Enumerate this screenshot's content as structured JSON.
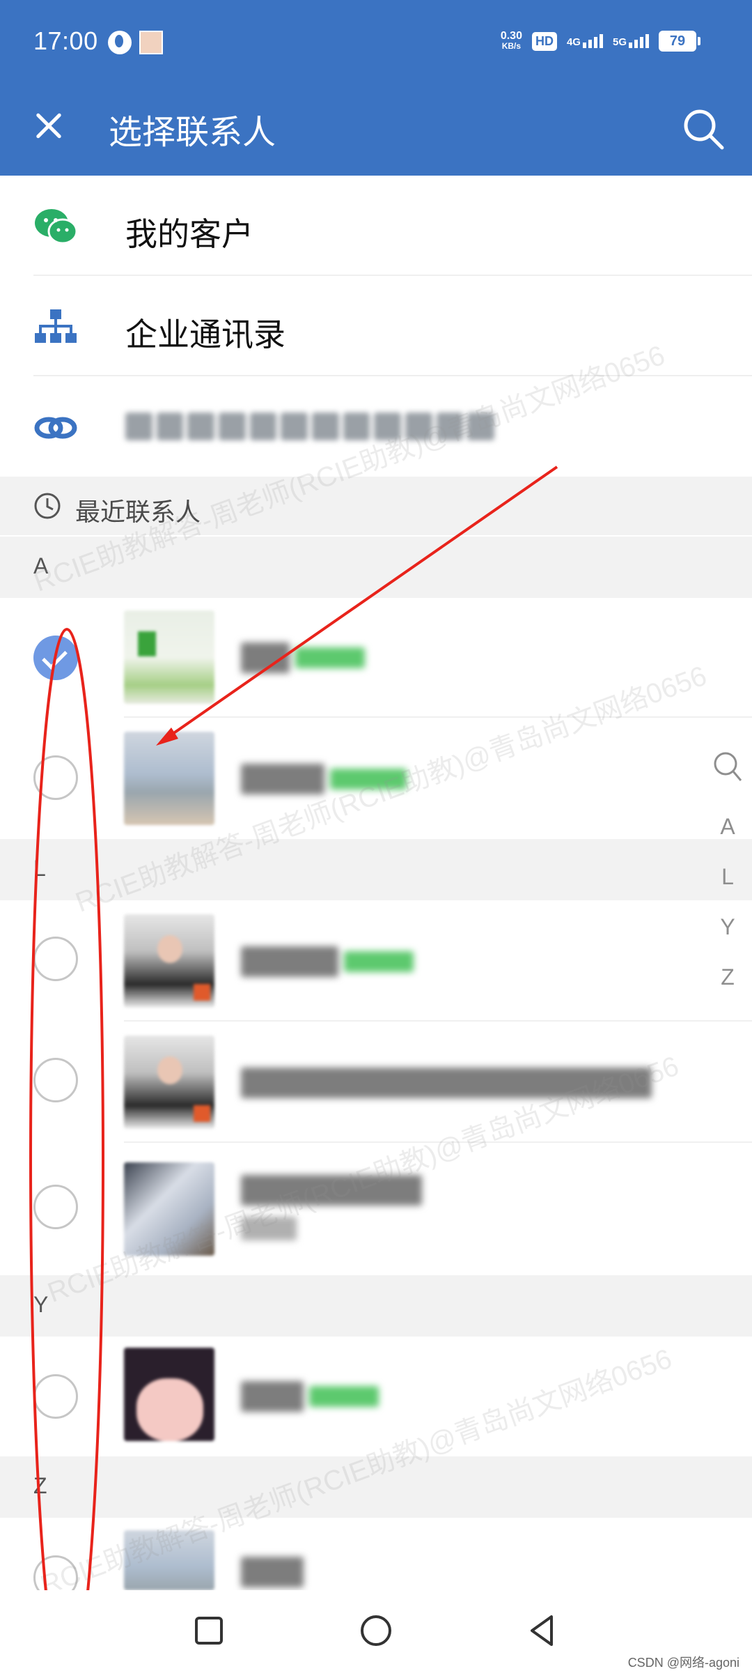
{
  "status_bar": {
    "time": "17:00",
    "speed_value": "0.30",
    "speed_unit": "KB/s",
    "hd": "HD",
    "sim": "1 2",
    "network_4g": "4G",
    "network_5g": "5G",
    "battery": "79"
  },
  "header": {
    "title": "选择联系人"
  },
  "menu": [
    {
      "label": "我的客户",
      "icon": "wechat-icon"
    },
    {
      "label": "企业通讯录",
      "icon": "org-chart-icon"
    },
    {
      "label": "",
      "icon": "link-icon"
    }
  ],
  "recent": {
    "label": "最近联系人"
  },
  "sections": [
    "A",
    "L",
    "Y",
    "Z"
  ],
  "contacts": [
    {
      "section": "A",
      "checked": true
    },
    {
      "section": "A",
      "checked": false
    },
    {
      "section": "L",
      "checked": false
    },
    {
      "section": "L",
      "checked": false
    },
    {
      "section": "L",
      "checked": false
    },
    {
      "section": "Y",
      "checked": false
    },
    {
      "section": "Z",
      "checked": false
    }
  ],
  "index_bar": [
    "A",
    "L",
    "Y",
    "Z"
  ],
  "watermark": "RCIE助教解答-周老师(RCIE助教)@青岛尚文网络0656",
  "credit": "CSDN @网络-agoni",
  "colors": {
    "header": "#3b73c2",
    "checked": "#6f99e3",
    "annotation": "#e8231b",
    "wechat": "#2aae67"
  }
}
